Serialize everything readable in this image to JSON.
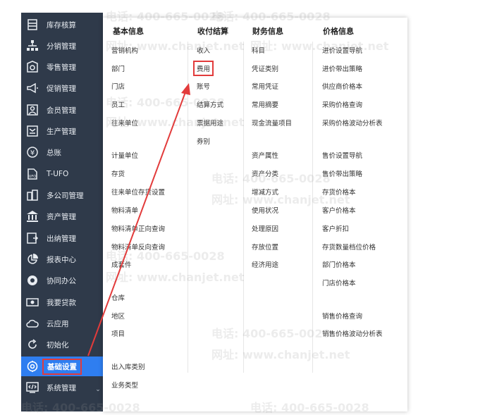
{
  "sidebar": {
    "items": [
      {
        "label": "库存核算",
        "icon": "inventory-icon"
      },
      {
        "label": "分销管理",
        "icon": "distribution-icon"
      },
      {
        "label": "零售管理",
        "icon": "retail-icon"
      },
      {
        "label": "促销管理",
        "icon": "megaphone-icon"
      },
      {
        "label": "会员管理",
        "icon": "member-icon"
      },
      {
        "label": "生产管理",
        "icon": "production-icon"
      },
      {
        "label": "总账",
        "icon": "ledger-icon"
      },
      {
        "label": "T-UFO",
        "icon": "ufo-icon"
      },
      {
        "label": "多公司管理",
        "icon": "multi-company-icon"
      },
      {
        "label": "资产管理",
        "icon": "bank-icon"
      },
      {
        "label": "出纳管理",
        "icon": "cashier-icon"
      },
      {
        "label": "报表中心",
        "icon": "pie-chart-icon"
      },
      {
        "label": "协同办公",
        "icon": "collaboration-icon"
      },
      {
        "label": "我要贷款",
        "icon": "loan-icon"
      },
      {
        "label": "云应用",
        "icon": "cloud-icon"
      },
      {
        "label": "初始化",
        "icon": "refresh-icon"
      },
      {
        "label": "基础设置",
        "icon": "settings-icon"
      },
      {
        "label": "系统管理",
        "icon": "code-icon"
      }
    ],
    "active_index": 16
  },
  "menu": {
    "col1": {
      "title": "基本信息",
      "items": [
        "营销机构",
        "部门",
        "门店",
        "员工",
        "往来单位",
        "计量单位",
        "存货",
        "往来单位存货设置",
        "物料清单",
        "物料清单正向查询",
        "物料清单反向查询",
        "成套件",
        "仓库",
        "地区",
        "项目",
        "出入库类别",
        "业务类型"
      ]
    },
    "col2": {
      "title": "收付结算",
      "items": [
        "收入",
        "费用",
        "账号",
        "结算方式",
        "票据用途",
        "券别"
      ]
    },
    "col3": {
      "title": "财务信息",
      "items": [
        "科目",
        "凭证类别",
        "常用凭证",
        "常用摘要",
        "现金流量项目",
        "资产属性",
        "资产分类",
        "增减方式",
        "使用状况",
        "处理原因",
        "存放位置",
        "经济用途"
      ]
    },
    "col4": {
      "title": "价格信息",
      "items": [
        "进价设置导航",
        "进价带出策略",
        "供应商价格本",
        "采购价格查询",
        "采购价格波动分析表",
        "售价设置导航",
        "售价带出策略",
        "存货价格本",
        "客户价格本",
        "客户折扣",
        "存货数量档位价格",
        "部门价格本",
        "门店价格本",
        "销售价格查询",
        "销售价格波动分析表"
      ]
    }
  },
  "watermark": {
    "phone": "电话: 400-665-0028",
    "site": "网址: www.chanjet.net"
  },
  "colors": {
    "sidebar_bg": "#2f3a4a",
    "active_bg": "#2f7ef0",
    "highlight": "#e23b3b"
  }
}
